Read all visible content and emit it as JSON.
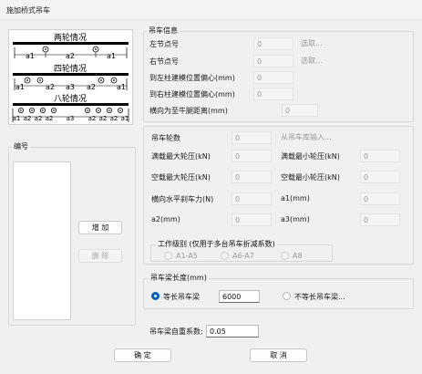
{
  "window": {
    "title": "施加桥式吊车"
  },
  "diagram": {
    "two_wheel": {
      "title": "两轮情况",
      "dims": [
        "a1",
        "a2",
        "a1"
      ]
    },
    "four_wheel": {
      "title": "四轮情况",
      "dims": [
        "a1",
        "a2",
        "a3",
        "a2",
        "a1"
      ]
    },
    "eight_wheel": {
      "title": "八轮情况",
      "dims": [
        "a1",
        "a2",
        "a2",
        "a2",
        "a3",
        "a2",
        "a2",
        "a2",
        "a1"
      ]
    }
  },
  "crane_info": {
    "legend": "吊车信息",
    "left_node": {
      "label": "左节点号",
      "value": "0",
      "button": "选取..."
    },
    "right_node": {
      "label": "右节点号",
      "value": "0",
      "button": "选取..."
    },
    "left_offset": {
      "label": "到左柱建模位置偏心(mm)",
      "value": "0"
    },
    "right_offset": {
      "label": "到右柱建模位置偏心(mm)",
      "value": "0"
    },
    "corbel_distance": {
      "label": "横向为至牛腿距离(mm)",
      "value": "0"
    }
  },
  "crane_params": {
    "wheel_count": {
      "label": "吊车轮数",
      "value": "0",
      "button": "从吊车库输入..."
    },
    "full_max": {
      "label": "满载最大轮压(kN)",
      "value": "0"
    },
    "full_min": {
      "label": "满载最小轮压(kN)",
      "value": "0"
    },
    "empty_max": {
      "label": "空载最大轮压(kN)",
      "value": "0"
    },
    "empty_min": {
      "label": "空载最小轮压(kN)",
      "value": "0"
    },
    "brake_force": {
      "label": "横向水平刹车力(N)",
      "value": "0"
    },
    "a1": {
      "label": "a1(mm)",
      "value": "0"
    },
    "a2": {
      "label": "a2(mm)",
      "value": "0"
    },
    "a3": {
      "label": "a3(mm)",
      "value": "0"
    }
  },
  "work_level": {
    "legend": "工作级别 (仅用于多台吊车折减系数)",
    "options": [
      "A1-A5",
      "A6-A7",
      "A8"
    ]
  },
  "beam_length": {
    "legend": "吊车梁长度(mm)",
    "equal_label": "等长吊车梁",
    "equal_value": "6000",
    "unequal_label": "不等长吊车梁..."
  },
  "self_weight": {
    "label": "吊车梁自重系数:",
    "value": "0.05"
  },
  "numbering": {
    "legend": "编号",
    "add_button": "增 加",
    "delete_button": "删 除"
  },
  "footer": {
    "ok": "确 定",
    "cancel": "取 消"
  }
}
